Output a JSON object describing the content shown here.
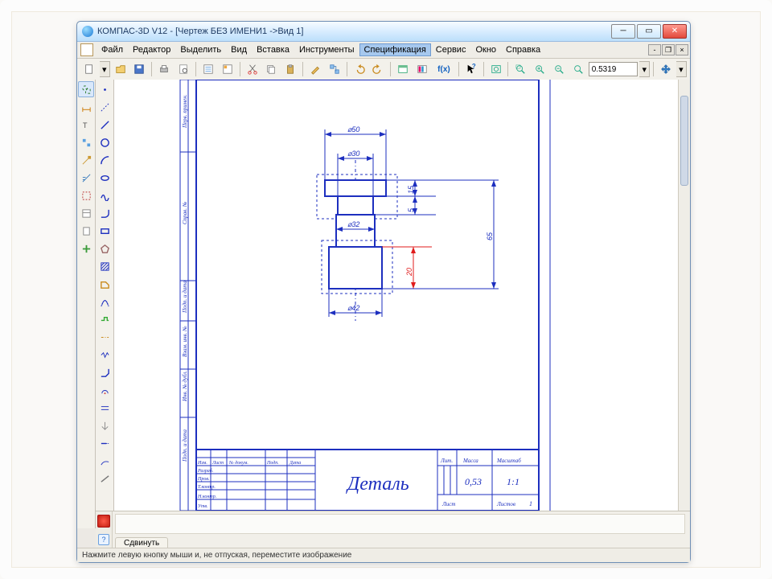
{
  "window": {
    "title": "КОМПАС-3D V12 - [Чертеж БЕЗ ИМЕНИ1 ->Вид 1]"
  },
  "menu": {
    "file": "Файл",
    "editor": "Редактор",
    "select": "Выделить",
    "view": "Вид",
    "insert": "Вставка",
    "tools": "Инструменты",
    "spec": "Спецификация",
    "service": "Сервис",
    "window": "Окно",
    "help": "Справка"
  },
  "toolbar": {
    "zoom_value": "0.5319",
    "fx_label": "f(x)"
  },
  "drawing": {
    "dims": {
      "d50": "⌀50",
      "d30": "⌀30",
      "d32": "⌀32",
      "d42": "⌀42",
      "h15": "15",
      "h5": "5",
      "h20": "20",
      "h65": "65"
    },
    "titleblock": {
      "name": "Деталь",
      "mass_hdr": "Масса",
      "scale_hdr": "Масштаб",
      "lit_hdr": "Лит.",
      "mass": "0,53",
      "scale": "1:1",
      "sheet": "Лист",
      "sheets": "Листов",
      "sheets_n": "1",
      "row_izm": "Изм.",
      "row_list": "Лист",
      "row_ndok": "№ докум.",
      "row_podp": "Подп.",
      "row_data": "Дата",
      "row_razrab": "Разраб.",
      "row_prov": "Пров.",
      "row_tkontr": "Т.контр.",
      "row_nkontr": "Н.контр.",
      "row_utv": "Утв."
    }
  },
  "prop_panel": {
    "tab": "Сдвинуть"
  },
  "status": {
    "hint": "Нажмите левую кнопку мыши и, не отпуская, переместите изображение"
  }
}
